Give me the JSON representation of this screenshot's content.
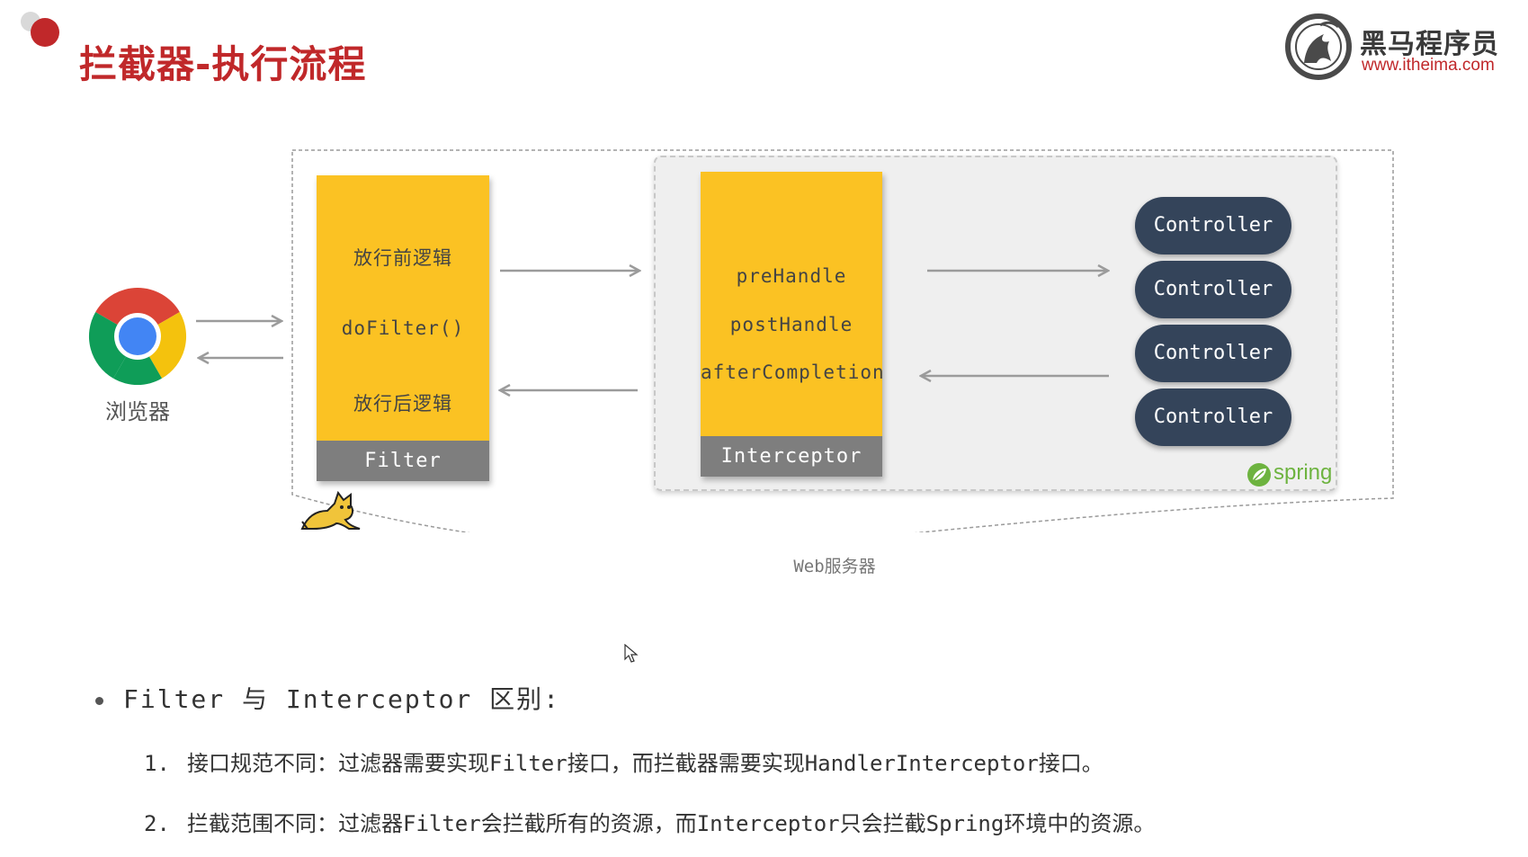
{
  "header": {
    "title": "拦截器-执行流程",
    "logo_name": "黑马程序员",
    "logo_url": "www.itheima.com"
  },
  "diagram": {
    "browser_label": "浏览器",
    "filter": {
      "before": "放行前逻辑",
      "call": "doFilter()",
      "after": "放行后逻辑",
      "label": "Filter"
    },
    "interceptor": {
      "methods": [
        "preHandle",
        "postHandle",
        "afterCompletion"
      ],
      "label": "Interceptor"
    },
    "controllers": [
      "Controller",
      "Controller",
      "Controller",
      "Controller"
    ],
    "spring_logo": "spring",
    "server_label": "Web服务器"
  },
  "content": {
    "heading": "Filter 与 Interceptor 区别:",
    "items": [
      {
        "num": "1.",
        "text": "接口规范不同：过滤器需要实现Filter接口，而拦截器需要实现HandlerInterceptor接口。"
      },
      {
        "num": "2.",
        "text": "拦截范围不同：过滤器Filter会拦截所有的资源，而Interceptor只会拦截Spring环境中的资源。"
      }
    ]
  },
  "colors": {
    "accent_red": "#c0282a",
    "block_yellow": "#fbc223",
    "block_foot_grey": "#7e7e7e",
    "controller_navy": "#34445a",
    "spring_green": "#6db33f"
  }
}
